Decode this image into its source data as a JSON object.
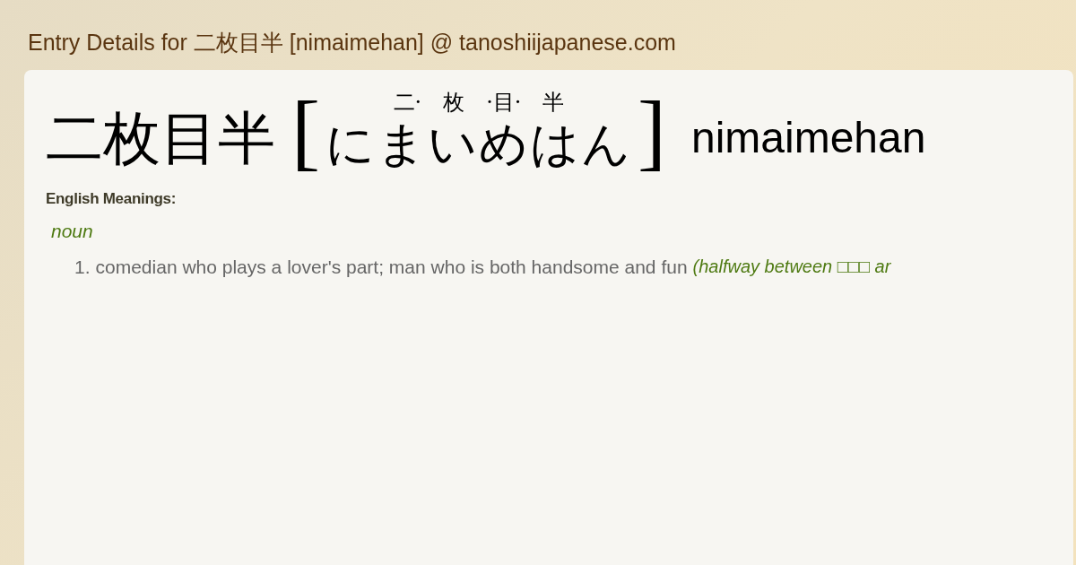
{
  "page_title": "Entry Details for 二枚目半 [nimaimehan] @ tanoshiijapanese.com",
  "entry": {
    "headword": "二枚目半",
    "bracket_open": "[",
    "bracket_close": "]",
    "furigana": "二·　枚　·目·　半",
    "reading": "にまいめはん",
    "romaji": "nimaimehan"
  },
  "meanings_label": "English Meanings:",
  "part_of_speech": "noun",
  "meanings": [
    {
      "number": "1.",
      "text": "comedian who plays a lover's part; man who is both handsome and fun",
      "note": "(halfway between □□□ ar"
    }
  ]
}
